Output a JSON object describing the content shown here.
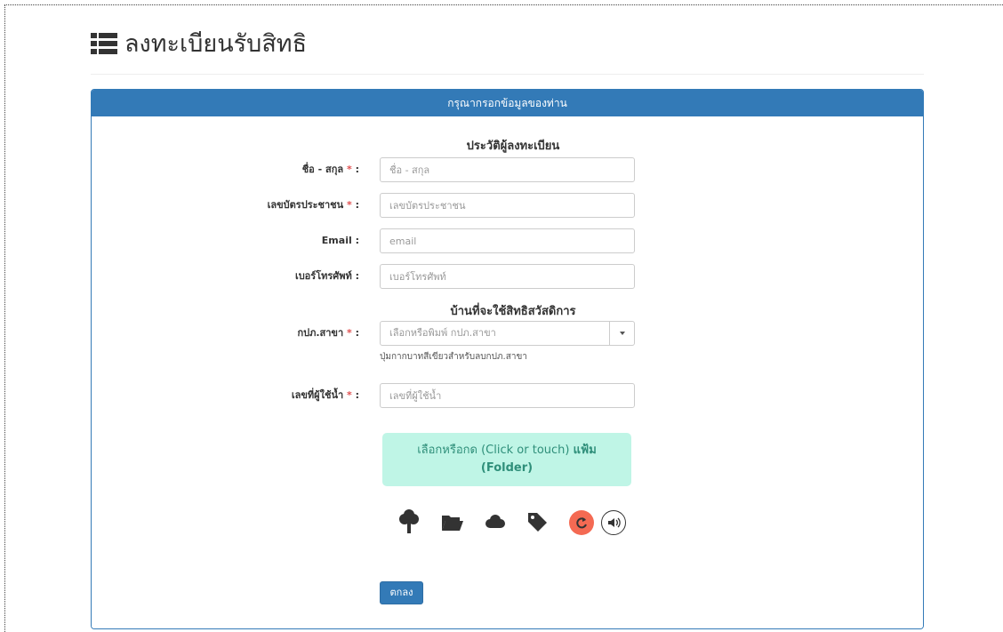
{
  "page": {
    "title": "ลงทะเบียนรับสิทธิ"
  },
  "panel": {
    "heading": "กรุณากรอกข้อมูลของท่าน"
  },
  "sections": {
    "registrant": "ประวัติผู้ลงทะเบียน",
    "welfare_house": "บ้านที่จะใช้สิทธิสวัสดิการ"
  },
  "fields": {
    "full_name": {
      "label": "ชื่อ - สกุล",
      "required_mark": "*",
      "colon": ":",
      "placeholder": "ชื่อ - สกุล",
      "value": ""
    },
    "citizen_id": {
      "label": "เลขบัตรประชาชน",
      "required_mark": "*",
      "colon": ":",
      "placeholder": "เลขบัตรประชาชน",
      "value": ""
    },
    "email": {
      "label": "Email",
      "colon": ":",
      "placeholder": "email",
      "value": ""
    },
    "phone": {
      "label": "เบอร์โทรศัพท์",
      "colon": ":",
      "placeholder": "เบอร์โทรศัพท์",
      "value": ""
    },
    "branch": {
      "label": "กปภ.สาขา",
      "required_mark": "*",
      "colon": ":",
      "placeholder": "เลือกหรือพิมพ์ กปภ.สาขา",
      "help": "ปุ่มกากบาทสีเขียวสำหรับลบกปภ.สาขา"
    },
    "water_user_no": {
      "label": "เลขที่ผู้ใช้น้ำ",
      "required_mark": "*",
      "colon": ":",
      "placeholder": "เลขที่ผู้ใช้น้ำ",
      "value": ""
    }
  },
  "upload": {
    "line1": "เลือกหรือกด (Click or touch)",
    "line1_bold": "แฟ้ม",
    "line2": "(Folder)"
  },
  "tools": [
    "tree-icon",
    "folder-open-icon",
    "cloud-icon",
    "tag-icon",
    "refresh-icon",
    "volume-icon"
  ],
  "colors": {
    "primary": "#337ab7",
    "upload_bg": "#bff5e6",
    "upload_text": "#2f8f7a",
    "refresh": "#f46a53",
    "required": "#e05050"
  },
  "submit": {
    "label": "ตกลง"
  }
}
